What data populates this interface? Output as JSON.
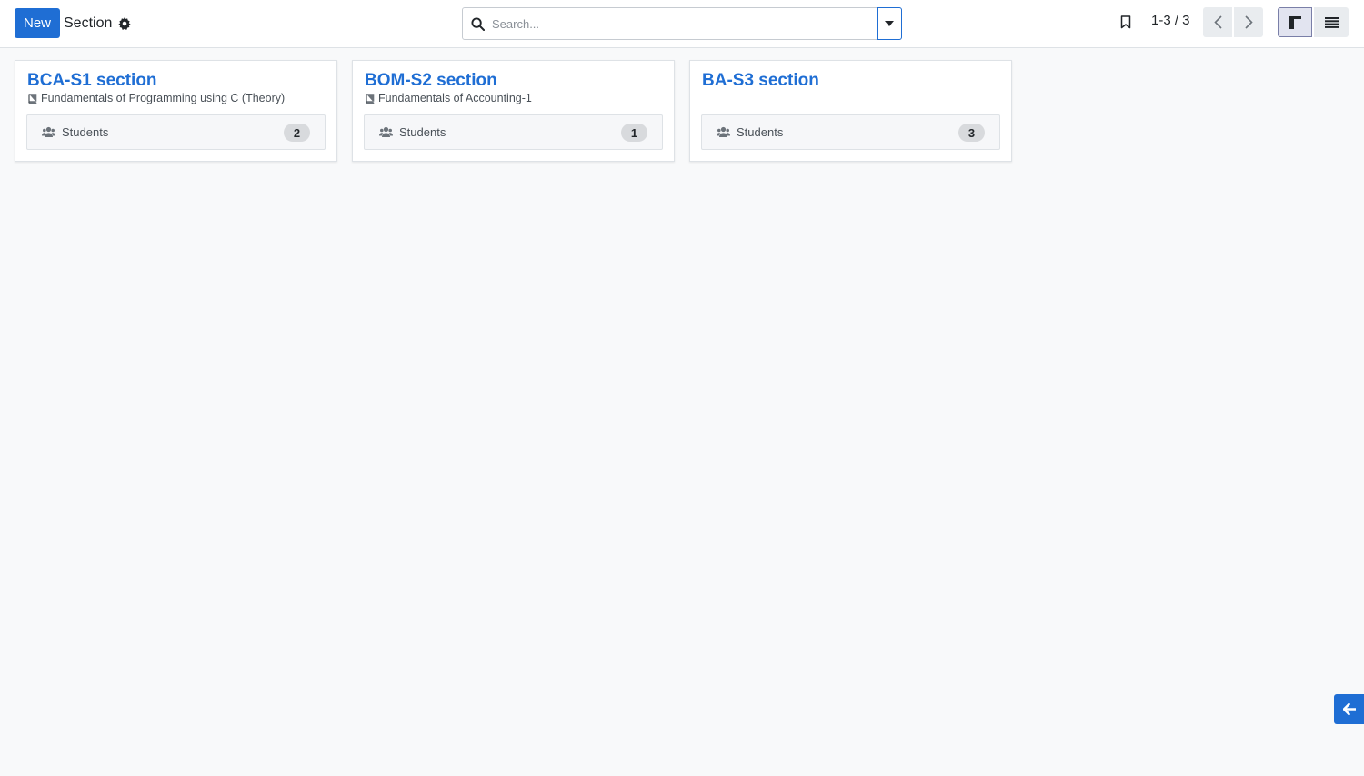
{
  "control_panel": {
    "new_button": "New",
    "title": "Section",
    "search": {
      "placeholder": "Search..."
    },
    "pager": {
      "value": "1-3 / 3"
    }
  },
  "icons": {
    "settings": "gear-icon",
    "search": "search-icon",
    "dropdown": "caret-down-icon",
    "favorite": "bookmark-icon",
    "prev": "chevron-left-icon",
    "next": "chevron-right-icon",
    "kanban_view": "kanban-icon",
    "list_view": "list-icon",
    "course": "book-icon",
    "students": "users-icon",
    "back": "arrow-left-icon"
  },
  "colors": {
    "primary": "#1f6ed4",
    "background": "#f8f9fa",
    "badge": "#d8dadd"
  },
  "cards": [
    {
      "title": "BCA-S1 section",
      "course": "Fundamentals of Programming using C (Theory)",
      "students_label": "Students",
      "students_count": "2"
    },
    {
      "title": "BOM-S2 section",
      "course": "Fundamentals of Accounting-1",
      "students_label": "Students",
      "students_count": "1"
    },
    {
      "title": "BA-S3 section",
      "course": "",
      "students_label": "Students",
      "students_count": "3"
    }
  ]
}
